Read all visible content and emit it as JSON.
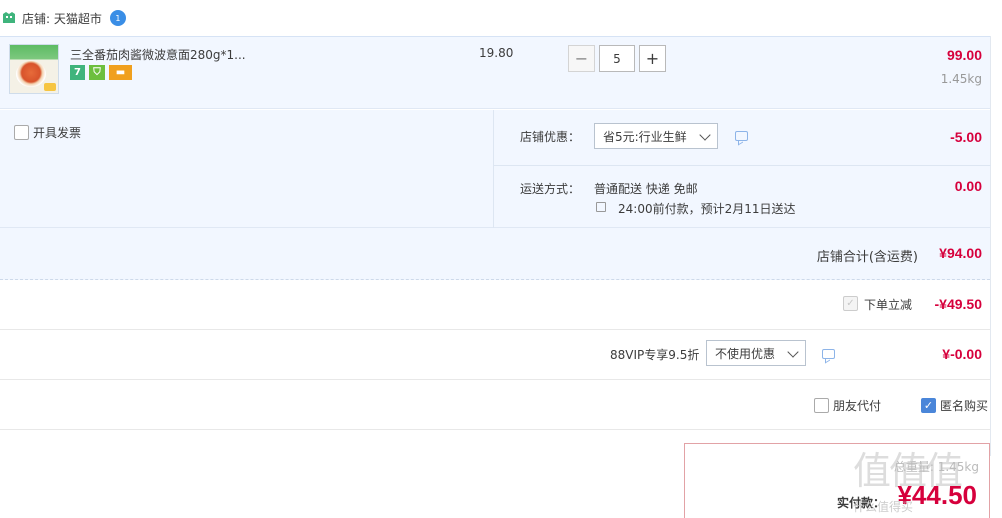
{
  "shop": {
    "label": "店铺: 天猫超市",
    "ww_badge": "1"
  },
  "item": {
    "title": "三全番茄肉酱微波意面280g*1...",
    "unit_price": "19.80",
    "quantity": "5",
    "minus": "−",
    "plus": "+",
    "total": "99.00",
    "weight": "1.45kg",
    "badges": [
      "7",
      "⛉",
      "▬"
    ]
  },
  "invoice": {
    "label": "开具发票"
  },
  "discount": {
    "label": "店铺优惠：",
    "selected": "省5元:行业生鲜",
    "amount": "-5.00"
  },
  "shipping": {
    "label": "运送方式：",
    "method": "普通配送 快递 免邮",
    "eta": "24:00前付款，预计2月11日送达",
    "amount": "0.00"
  },
  "shop_total": {
    "label": "店铺合计(含运费)",
    "value": "¥94.00"
  },
  "instant_discount": {
    "label": "下单立减",
    "value": "-¥49.50"
  },
  "vip": {
    "label": "88VIP专享9.5折",
    "selected": "不使用优惠",
    "value": "¥-0.00"
  },
  "options": {
    "friend_pay": "朋友代付",
    "anonymous": "匿名购买"
  },
  "payment": {
    "weight": "总重量: 1.45kg",
    "label": "实付款：",
    "amount": "¥44.50"
  },
  "watermark": {
    "text": "值值值",
    "site": "什么值得买"
  },
  "colors": {
    "accent_red": "#d6003c",
    "panel_bg": "#f2f7ff",
    "check_blue": "#4a86d9"
  }
}
